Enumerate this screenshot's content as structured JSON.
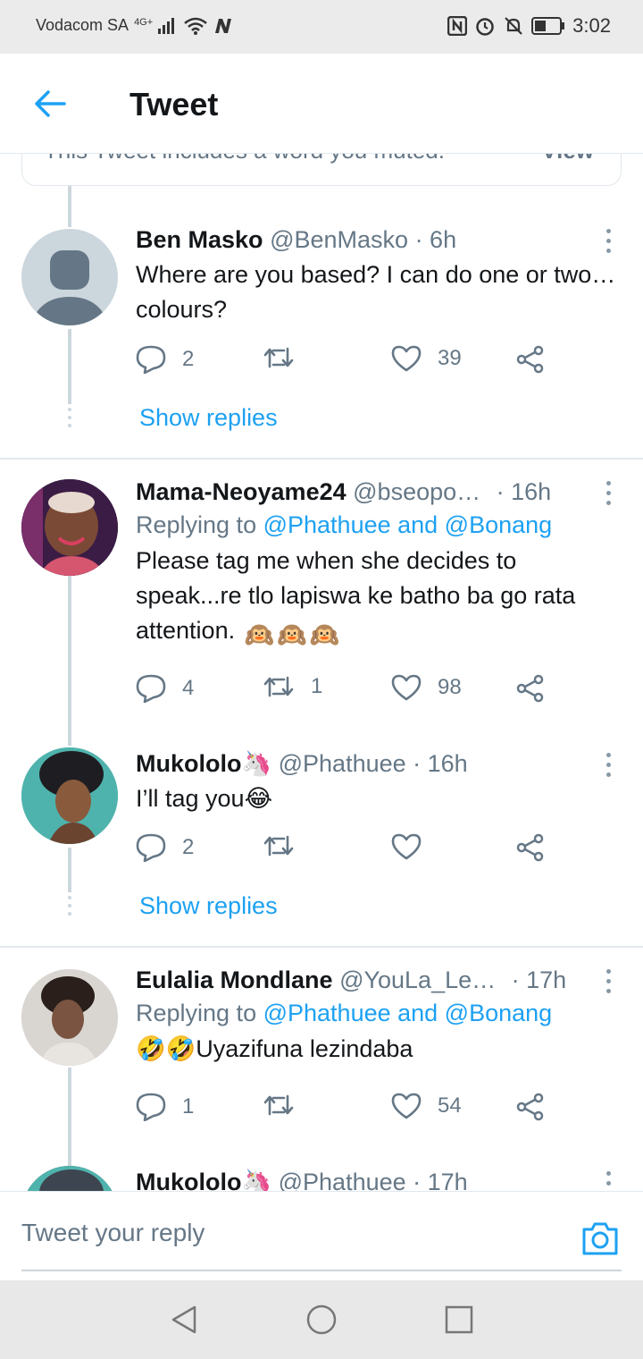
{
  "status_bar": {
    "carrier": "Vodacom SA",
    "network": "4G+",
    "time": "3:02",
    "icons": [
      "signal-icon",
      "wifi-icon",
      "n-app-icon",
      "nfc-icon",
      "alarm-icon",
      "mute-icon",
      "battery-icon"
    ]
  },
  "header": {
    "title": "Tweet",
    "back_icon": "arrow-left-icon"
  },
  "muted_notice": {
    "text": "This Tweet includes a word you muted.",
    "action": "View"
  },
  "tweets": [
    {
      "name": "Ben Masko",
      "handle": "@BenMasko",
      "time": "· 6h",
      "reply_to": "",
      "text": "Where are you based? I can do one or two…colours?",
      "replies": "2",
      "retweets": "",
      "likes": "39",
      "show_replies": "Show replies"
    },
    {
      "name": "Mama-Neoyame24",
      "handle": "@bseopo…",
      "time": "· 16h",
      "reply_prefix": "Replying to",
      "reply_to": "@Phathuee and @Bonang",
      "text": "Please tag me when she decides to speak...re tlo lapiswa ke batho ba go rata attention.",
      "emoji": [
        "🙉",
        "🙉",
        "🙉"
      ],
      "replies": "4",
      "retweets": "1",
      "likes": "98"
    },
    {
      "name": "Mukololo",
      "name_emoji": "🦄",
      "handle": "@Phathuee",
      "time": "· 16h",
      "reply_to": "",
      "text": "I’ll tag you",
      "emoji": [
        "😂"
      ],
      "replies": "2",
      "retweets": "",
      "likes": "",
      "show_replies": "Show replies"
    },
    {
      "name": "Eulalia Mondlane",
      "handle": "@YouLa_Le…",
      "time": "· 17h",
      "reply_prefix": "Replying to",
      "reply_to": "@Phathuee and @Bonang",
      "emoji": [
        "🤣",
        "🤣"
      ],
      "text": "Uyazifuna lezindaba",
      "replies": "1",
      "retweets": "",
      "likes": "54"
    },
    {
      "name": "Mukololo",
      "name_emoji": "🦄",
      "handle": "@Phathuee",
      "time": "· 17h"
    }
  ],
  "reply_bar": {
    "placeholder": "Tweet your reply",
    "camera_icon": "camera-icon"
  },
  "nav": {
    "back": "nav-back-icon",
    "home": "nav-home-icon",
    "recents": "nav-recents-icon"
  }
}
